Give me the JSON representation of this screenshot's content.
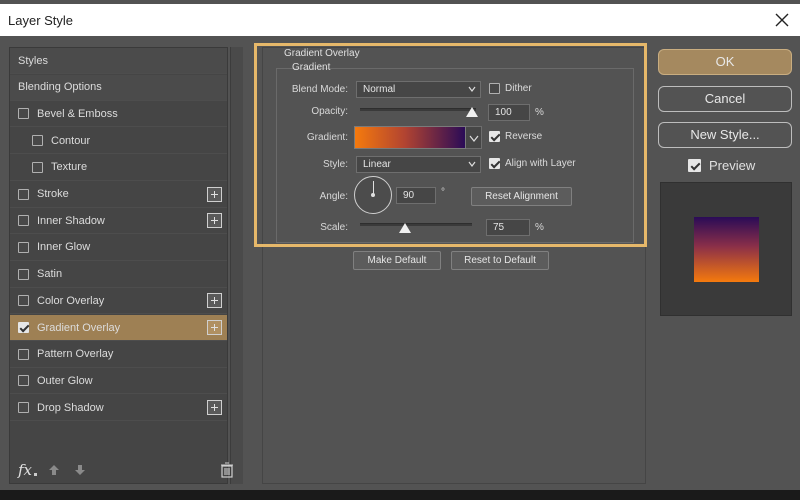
{
  "window": {
    "title": "Layer Style"
  },
  "styles_panel": {
    "items": [
      {
        "label": "Styles",
        "has_checkbox": false,
        "checked": false,
        "indent": 0,
        "has_plus": false,
        "selected": false,
        "header": true
      },
      {
        "label": "Blending Options",
        "has_checkbox": false,
        "checked": false,
        "indent": 0,
        "has_plus": false,
        "selected": false,
        "header": true
      },
      {
        "label": "Bevel & Emboss",
        "has_checkbox": true,
        "checked": false,
        "indent": 0,
        "has_plus": false,
        "selected": false
      },
      {
        "label": "Contour",
        "has_checkbox": true,
        "checked": false,
        "indent": 1,
        "has_plus": false,
        "selected": false
      },
      {
        "label": "Texture",
        "has_checkbox": true,
        "checked": false,
        "indent": 1,
        "has_plus": false,
        "selected": false
      },
      {
        "label": "Stroke",
        "has_checkbox": true,
        "checked": false,
        "indent": 0,
        "has_plus": true,
        "selected": false
      },
      {
        "label": "Inner Shadow",
        "has_checkbox": true,
        "checked": false,
        "indent": 0,
        "has_plus": true,
        "selected": false
      },
      {
        "label": "Inner Glow",
        "has_checkbox": true,
        "checked": false,
        "indent": 0,
        "has_plus": false,
        "selected": false
      },
      {
        "label": "Satin",
        "has_checkbox": true,
        "checked": false,
        "indent": 0,
        "has_plus": false,
        "selected": false
      },
      {
        "label": "Color Overlay",
        "has_checkbox": true,
        "checked": false,
        "indent": 0,
        "has_plus": true,
        "selected": false
      },
      {
        "label": "Gradient Overlay",
        "has_checkbox": true,
        "checked": true,
        "indent": 0,
        "has_plus": true,
        "selected": true
      },
      {
        "label": "Pattern Overlay",
        "has_checkbox": true,
        "checked": false,
        "indent": 0,
        "has_plus": false,
        "selected": false
      },
      {
        "label": "Outer Glow",
        "has_checkbox": true,
        "checked": false,
        "indent": 0,
        "has_plus": false,
        "selected": false
      },
      {
        "label": "Drop Shadow",
        "has_checkbox": true,
        "checked": false,
        "indent": 0,
        "has_plus": true,
        "selected": false
      }
    ],
    "footer": {
      "fx_label": "fx"
    }
  },
  "gradient_overlay": {
    "section_title": "Gradient Overlay",
    "group_title": "Gradient",
    "blend_mode": {
      "label": "Blend Mode:",
      "value": "Normal"
    },
    "dither": {
      "label": "Dither",
      "checked": false
    },
    "opacity": {
      "label": "Opacity:",
      "value": "100",
      "unit": "%",
      "level": 1.0
    },
    "gradient": {
      "label": "Gradient:",
      "colors": [
        "#f57a0d",
        "#b24431",
        "#2a0b57"
      ]
    },
    "reverse": {
      "label": "Reverse",
      "checked": true
    },
    "style": {
      "label": "Style:",
      "value": "Linear"
    },
    "align_with_layer": {
      "label": "Align with Layer",
      "checked": true
    },
    "angle": {
      "label": "Angle:",
      "value": "90",
      "unit": "°"
    },
    "reset_alignment_label": "Reset Alignment",
    "scale": {
      "label": "Scale:",
      "value": "75",
      "unit": "%",
      "level": 0.4
    },
    "make_default_label": "Make Default",
    "reset_to_default_label": "Reset to Default"
  },
  "right_panel": {
    "ok_label": "OK",
    "cancel_label": "Cancel",
    "new_style_label": "New Style...",
    "preview": {
      "label": "Preview",
      "checked": true
    }
  },
  "colors": {
    "accent": "#a5895f",
    "highlight": "#e6b86a",
    "selected_row": "#9e8054"
  },
  "icons": [
    "close-icon",
    "fx-icon",
    "arrow-up-icon",
    "arrow-down-icon",
    "trash-icon",
    "chevron-down-icon",
    "plus-icon",
    "checkbox-icon",
    "angle-dial-icon"
  ]
}
